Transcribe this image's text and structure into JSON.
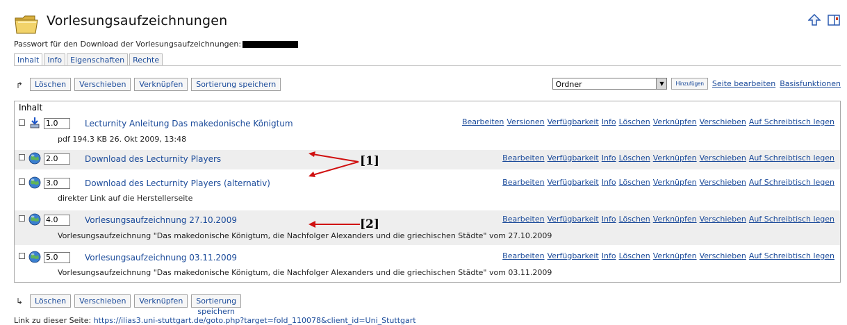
{
  "header": {
    "title": "Vorlesungsaufzeichnungen",
    "folder_icon": "folder-icon",
    "icons": [
      "up-arrow-icon",
      "layout-icon"
    ]
  },
  "password_line": "Passwort für den Download der Vorlesungsaufzeichnungen:",
  "tabs": [
    {
      "label": "Inhalt",
      "active": true
    },
    {
      "label": "Info",
      "active": false
    },
    {
      "label": "Eigenschaften",
      "active": false
    },
    {
      "label": "Rechte",
      "active": false
    }
  ],
  "toolbar": {
    "buttons": [
      "Löschen",
      "Verschieben",
      "Verknüpfen",
      "Sortierung speichern"
    ],
    "select_value": "Ordner",
    "add_button": "Hinzufügen",
    "links": [
      "Seite bearbeiten",
      "Basisfunktionen"
    ]
  },
  "panel": {
    "heading": "Inhalt",
    "items": [
      {
        "pos": "1.0",
        "icon": "download-arrow-icon",
        "title": "Lecturnity Anleitung Das makedonische Königtum",
        "actions": [
          "Bearbeiten",
          "Versionen",
          "Verfügbarkeit",
          "Info",
          "Löschen",
          "Verknüpfen",
          "Verschieben",
          "Auf Schreibtisch legen"
        ],
        "sub": "pdf   194.3 KB   26. Okt 2009, 13:48"
      },
      {
        "pos": "2.0",
        "icon": "globe-icon",
        "title": "Download des Lecturnity Players",
        "actions": [
          "Bearbeiten",
          "Verfügbarkeit",
          "Info",
          "Löschen",
          "Verknüpfen",
          "Verschieben",
          "Auf Schreibtisch legen"
        ],
        "sub": ""
      },
      {
        "pos": "3.0",
        "icon": "globe-icon",
        "title": "Download des Lecturnity Players (alternativ)",
        "actions": [
          "Bearbeiten",
          "Verfügbarkeit",
          "Info",
          "Löschen",
          "Verknüpfen",
          "Verschieben",
          "Auf Schreibtisch legen"
        ],
        "sub": "direkter Link auf die Herstellerseite"
      },
      {
        "pos": "4.0",
        "icon": "globe-icon",
        "title": "Vorlesungsaufzeichnung 27.10.2009",
        "actions": [
          "Bearbeiten",
          "Verfügbarkeit",
          "Info",
          "Löschen",
          "Verknüpfen",
          "Verschieben",
          "Auf Schreibtisch legen"
        ],
        "sub": "Vorlesungsaufzeichnung \"Das makedonische Königtum, die Nachfolger Alexanders und die griechischen Städte\" vom 27.10.2009"
      },
      {
        "pos": "5.0",
        "icon": "globe-icon",
        "title": "Vorlesungsaufzeichnung 03.11.2009",
        "actions": [
          "Bearbeiten",
          "Verfügbarkeit",
          "Info",
          "Löschen",
          "Verknüpfen",
          "Verschieben",
          "Auf Schreibtisch legen"
        ],
        "sub": "Vorlesungsaufzeichnung \"Das makedonische Königtum, die Nachfolger Alexanders und die griechischen Städte\" vom 03.11.2009"
      }
    ]
  },
  "annotations": [
    "[1]",
    "[2]"
  ],
  "footer": {
    "label": "Link zu dieser Seite:",
    "url": "https://ilias3.uni-stuttgart.de/goto.php?target=fold_110078&client_id=Uni_Stuttgart"
  },
  "colors": {
    "link": "#1a4a9a",
    "alt_row": "#eeeeee",
    "border": "#a8a8a8"
  }
}
